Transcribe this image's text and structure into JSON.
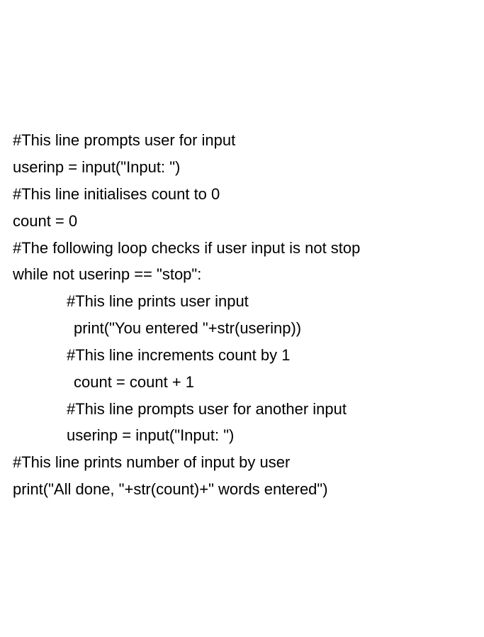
{
  "code": {
    "lines": [
      {
        "text": "#This line prompts user for input",
        "indent": 0
      },
      {
        "text": "userinp = input(\"Input: \")",
        "indent": 0
      },
      {
        "text": "#This line initialises count to 0",
        "indent": 0
      },
      {
        "text": "count = 0",
        "indent": 0
      },
      {
        "text": "#The following loop checks if user input is not stop",
        "indent": 0
      },
      {
        "text": "while not userinp == \"stop\":",
        "indent": 0
      },
      {
        "text": "#This line prints user input",
        "indent": 1
      },
      {
        "text": "print(\"You entered \"+str(userinp))",
        "indent": 2
      },
      {
        "text": "#This line increments count by 1",
        "indent": 1
      },
      {
        "text": "count = count + 1",
        "indent": 2
      },
      {
        "text": "#This line prompts user for another input",
        "indent": 1
      },
      {
        "text": "userinp = input(\"Input: \")",
        "indent": 1
      },
      {
        "text": "",
        "indent": 0
      },
      {
        "text": "#This line prints number of input by user",
        "indent": 0
      },
      {
        "text": "print(\"All done, \"+str(count)+\" words entered\")",
        "indent": 0
      }
    ]
  }
}
